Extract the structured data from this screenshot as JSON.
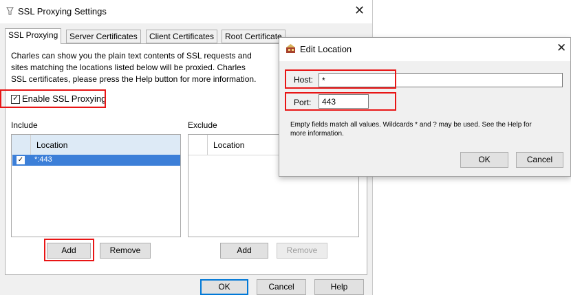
{
  "main_dialog": {
    "title": "SSL Proxying Settings",
    "tabs": [
      {
        "label": "SSL Proxying",
        "active": true
      },
      {
        "label": "Server Certificates",
        "active": false
      },
      {
        "label": "Client Certificates",
        "active": false
      },
      {
        "label": "Root Certificate",
        "active": false
      }
    ],
    "description": [
      "Charles can show you the plain text contents of SSL requests and",
      "sites matching the locations listed below will be proxied. Charles",
      "SSL certificates, please press the Help button for more information."
    ],
    "enable_ssl_label": "Enable SSL Proxying",
    "enable_ssl_checked": true,
    "include": {
      "label": "Include",
      "column": "Location",
      "rows": [
        {
          "checked": true,
          "text": "*:443"
        }
      ],
      "add_label": "Add",
      "remove_label": "Remove"
    },
    "exclude": {
      "label": "Exclude",
      "column": "Location",
      "rows": [],
      "add_label": "Add",
      "remove_label": "Remove"
    },
    "ok_label": "OK",
    "cancel_label": "Cancel",
    "help_label": "Help"
  },
  "edit_dialog": {
    "title": "Edit Location",
    "host_label": "Host:",
    "host_value": "*",
    "port_label": "Port:",
    "port_value": "443",
    "help_text": [
      "Empty fields match all values. Wildcards * and ? may be used. See the Help for",
      "more information."
    ],
    "ok_label": "OK",
    "cancel_label": "Cancel"
  },
  "colors": {
    "highlight": "#e81515",
    "selection": "#3c7fd8",
    "header_bg": "#ddeaf6",
    "focus": "#0078d7"
  },
  "check_glyph": "✓"
}
